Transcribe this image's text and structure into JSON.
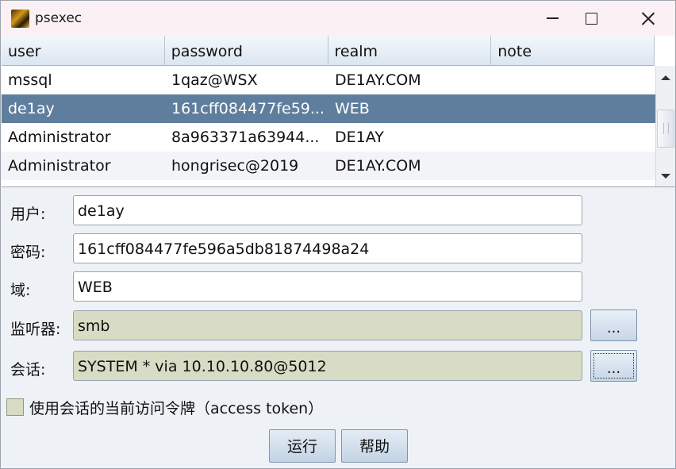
{
  "window": {
    "title": "psexec"
  },
  "table": {
    "columns": [
      "user",
      "password",
      "realm",
      "note"
    ],
    "rows": [
      {
        "user": "mssql",
        "password": "1qaz@WSX",
        "realm": "DE1AY.COM",
        "note": ""
      },
      {
        "user": "de1ay",
        "password": "161cff084477fe59...",
        "realm": "WEB",
        "note": ""
      },
      {
        "user": "Administrator",
        "password": "8a963371a63944...",
        "realm": "DE1AY",
        "note": ""
      },
      {
        "user": "Administrator",
        "password": "hongrisec@2019",
        "realm": "DE1AY.COM",
        "note": ""
      }
    ],
    "selected_row": 1
  },
  "form": {
    "user_label": "用户:",
    "user_value": "de1ay",
    "password_label": "密码:",
    "password_value": "161cff084477fe596a5db81874498a24",
    "realm_label": "域:",
    "realm_value": "WEB",
    "listener_label": "监听器:",
    "listener_value": "smb",
    "listener_button": "...",
    "session_label": "会话:",
    "session_value": "SYSTEM * via  10.10.10.80@5012",
    "session_button": "...",
    "token_checkbox_label": "使用会话的当前访问令牌（access token）",
    "token_checked": false
  },
  "buttons": {
    "run": "运行",
    "help": "帮助"
  },
  "icons": {
    "app": "app-icon",
    "minimize": "minimize-icon",
    "maximize": "maximize-icon",
    "close": "close-icon",
    "scroll_up": "chevron-up-icon",
    "scroll_down": "chevron-down-icon"
  },
  "colors": {
    "selected_row": "#5f7e9d",
    "readonly_field": "#d8dcc4",
    "title_bar": "#fbf1f5",
    "header": "#dbe6f1"
  }
}
